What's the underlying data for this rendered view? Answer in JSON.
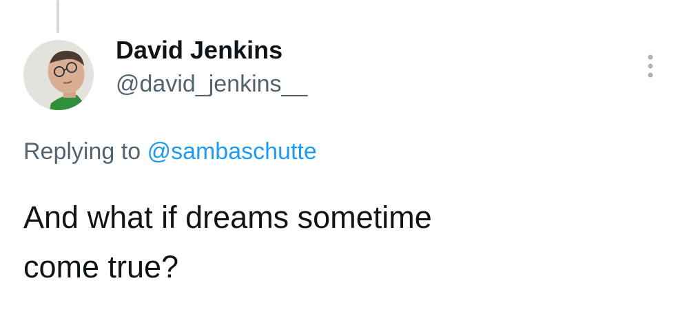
{
  "colors": {
    "text_primary": "#0f1419",
    "text_secondary": "#536471",
    "link": "#1d9bf0",
    "thread_line": "#cfd9de",
    "more_icon": "#a8b5bf"
  },
  "tweet": {
    "author": {
      "display_name": "David Jenkins",
      "handle": "@david_jenkins__",
      "avatar_icon": "profile-photo"
    },
    "reply": {
      "prefix": "Replying to",
      "target": "@sambaschutte"
    },
    "text_lines": [
      "And what if dreams sometime",
      "come true?"
    ],
    "more_icon": "more-vertical-icon"
  }
}
